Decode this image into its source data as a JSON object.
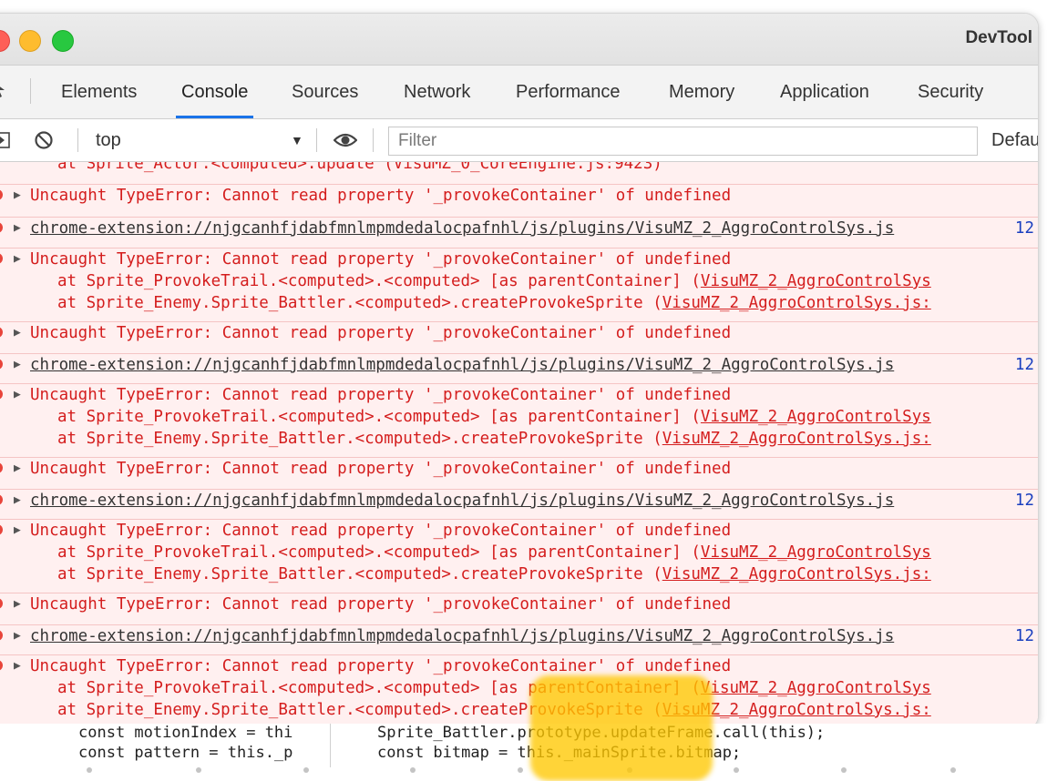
{
  "window": {
    "title": "DevTool"
  },
  "tabs": [
    {
      "label": "Elements"
    },
    {
      "label": "Console"
    },
    {
      "label": "Sources"
    },
    {
      "label": "Network"
    },
    {
      "label": "Performance"
    },
    {
      "label": "Memory"
    },
    {
      "label": "Application"
    },
    {
      "label": "Security"
    }
  ],
  "toolbar": {
    "context": "top",
    "filter_placeholder": "Filter",
    "levels": "Defau"
  },
  "console": {
    "partial_top": "at Sprite_Actor.<computed>.update (VisuMZ_0_CoreEngine.js:9423)",
    "error_text": "Uncaught TypeError: Cannot read property '_provokeContainer' of undefined",
    "ext_url": "chrome-extension://njgcanhfjdabfmnlmpmdedalocpafnhl/js/plugins/VisuMZ_2_AggroControlSys.js",
    "ext_line": "12",
    "stack1_prefix": "at Sprite_ProvokeTrail.<computed>.<computed> [as parentContainer] (",
    "stack1_link": "VisuMZ_2_AggroControlSys",
    "stack2_prefix": "at Sprite_Enemy.Sprite_Battler.<computed>.createProvokeSprite (",
    "stack2_link": "VisuMZ_2_AggroControlSys.js:"
  },
  "code": {
    "left1": "const motionIndex = thi",
    "left2": "const pattern = this._p",
    "right1": "Sprite_Battler.prototype.updateFrame.call(this);",
    "right2": "const bitmap = this._mainSprite.bitmap;"
  },
  "colors": {
    "error_red": "#d41d1d",
    "error_bg": "#fff0f0",
    "tab_active": "#1a73e8"
  }
}
